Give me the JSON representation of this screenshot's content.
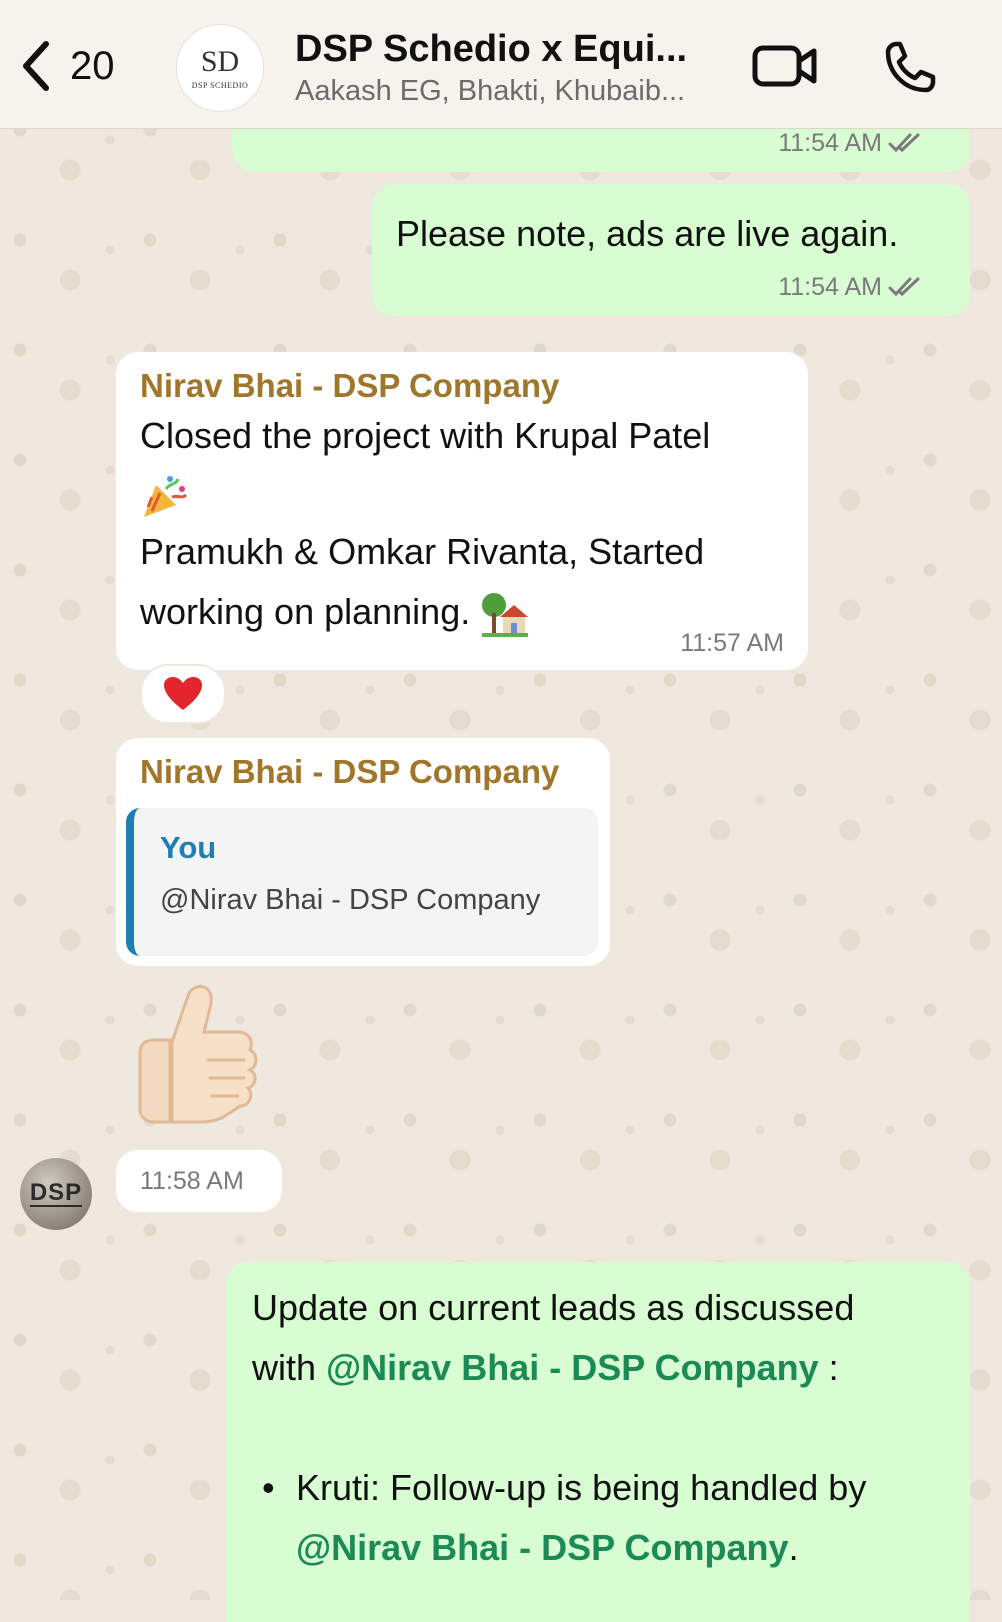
{
  "header": {
    "back_count": "20",
    "title": "DSP Schedio x Equi...",
    "subtitle": "Aakash EG, Bhakti, Khubaib...",
    "avatar_monogram": "SD",
    "avatar_brand": "DSP SCHEDIO"
  },
  "messages": {
    "m0": {
      "time": "11:54 AM"
    },
    "m1": {
      "text": "Please note, ads are live again.",
      "time": "11:54 AM"
    },
    "m2": {
      "sender": "Nirav Bhai - DSP Company",
      "line1": "Closed the project with Krupal Patel",
      "line2": "Pramukh & Omkar Rivanta, Started",
      "line3": "working on planning.",
      "time": "11:57 AM",
      "reaction": "❤️"
    },
    "m3": {
      "sender": "Nirav Bhai - DSP Company",
      "quote_author": "You",
      "quote_text": "@Nirav Bhai - DSP Company"
    },
    "m4": {
      "time": "11:58 AM",
      "sender_avatar": "DSP"
    },
    "m5": {
      "line1": "Update on current leads as discussed",
      "line2_prefix": "with ",
      "mention1": "@Nirav Bhai - DSP Company",
      "line2_suffix": " :",
      "bullet": "•",
      "bullet_text": "Kruti: Follow-up is being handled by",
      "mention2": "@Nirav Bhai - DSP Company",
      "bullet_suffix": "."
    }
  },
  "icons": {
    "back": "chevron-left-icon",
    "video": "video-camera-icon",
    "call": "phone-icon",
    "read": "double-check-icon"
  },
  "colors": {
    "outgoing_bubble": "#d9fdd3",
    "incoming_bubble": "#ffffff",
    "sender_name": "#a0762a",
    "mention": "#1b8a55",
    "quote_accent": "#1f7fb5"
  }
}
